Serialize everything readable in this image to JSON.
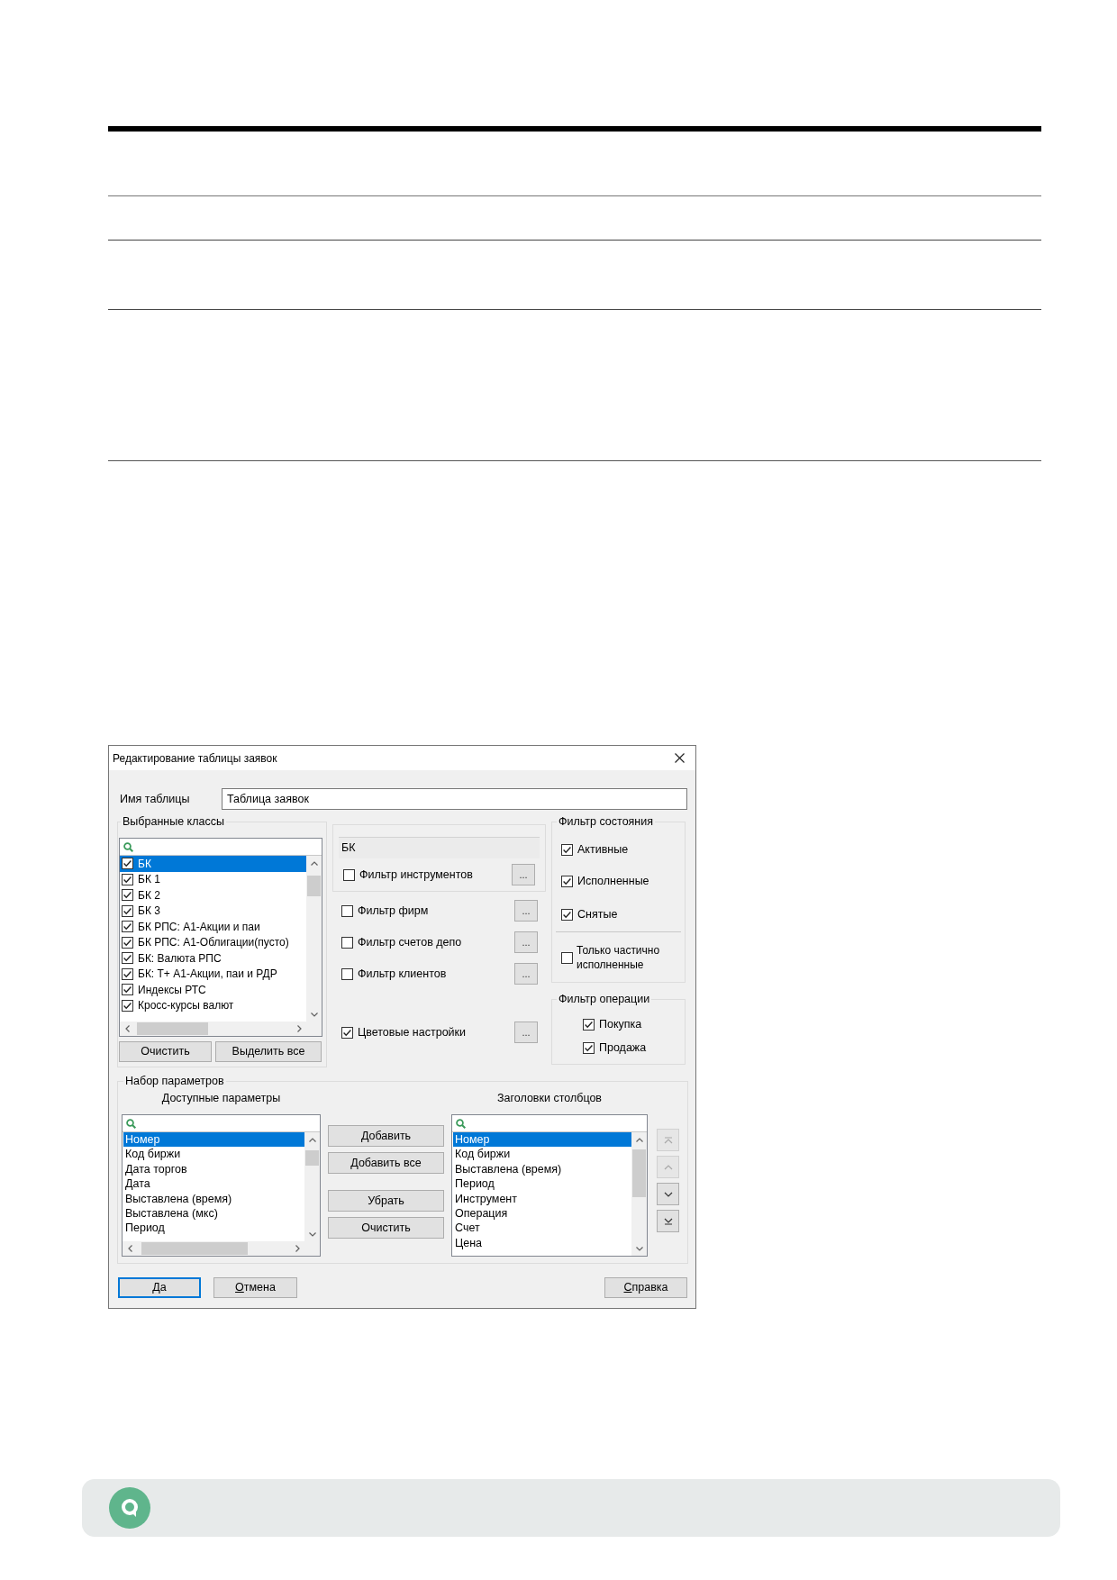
{
  "dialog": {
    "title": "Редактирование таблицы заявок",
    "table_name": {
      "label": "Имя таблицы",
      "value": "Таблица заявок"
    },
    "selected_classes": {
      "title": "Выбранные классы",
      "items": [
        {
          "label": "БК",
          "checked": true,
          "selected": true
        },
        {
          "label": "БК 1",
          "checked": true,
          "selected": false
        },
        {
          "label": "БК 2",
          "checked": true,
          "selected": false
        },
        {
          "label": "БК 3",
          "checked": true,
          "selected": false
        },
        {
          "label": "БК РПС: А1-Акции и паи",
          "checked": true,
          "selected": false
        },
        {
          "label": "БК РПС: А1-Облигации(пусто)",
          "checked": true,
          "selected": false
        },
        {
          "label": "БК: Валюта РПС",
          "checked": true,
          "selected": false
        },
        {
          "label": "БК: Т+ А1-Акции, паи и РДР",
          "checked": true,
          "selected": false
        },
        {
          "label": "Индексы РТС",
          "checked": true,
          "selected": false
        },
        {
          "label": "Кросс-курсы валют",
          "checked": true,
          "selected": false
        }
      ],
      "buttons": [
        "Очистить",
        "Выделить все"
      ]
    },
    "instrument_group": {
      "class_field": "БК",
      "filter": {
        "label": "Фильтр инструментов",
        "checked": false,
        "button": "..."
      }
    },
    "filters": [
      {
        "label": "Фильтр фирм",
        "checked": false,
        "button": "..."
      },
      {
        "label": "Фильтр счетов депо",
        "checked": false,
        "button": "..."
      },
      {
        "label": "Фильтр клиентов",
        "checked": false,
        "button": "..."
      }
    ],
    "color_settings": {
      "label": "Цветовые настройки",
      "checked": true,
      "button": "..."
    },
    "state_filter": {
      "title": "Фильтр состояния",
      "items": [
        {
          "label": "Активные",
          "checked": true
        },
        {
          "label": "Исполненные",
          "checked": true
        },
        {
          "label": "Снятые",
          "checked": true
        }
      ],
      "partial": {
        "label": "Только частично исполненные",
        "checked": false
      }
    },
    "operation_filter": {
      "title": "Фильтр операции",
      "items": [
        {
          "label": "Покупка",
          "checked": true
        },
        {
          "label": "Продажа",
          "checked": true
        }
      ]
    },
    "parameter_set": {
      "title": "Набор параметров",
      "available": {
        "title": "Доступные параметры",
        "items": [
          {
            "label": "Номер",
            "selected": true
          },
          {
            "label": "Код биржи",
            "selected": false
          },
          {
            "label": "Дата торгов",
            "selected": false
          },
          {
            "label": "Дата",
            "selected": false
          },
          {
            "label": "Выставлена (время)",
            "selected": false
          },
          {
            "label": "Выставлена (мкс)",
            "selected": false
          },
          {
            "label": "Период",
            "selected": false
          }
        ]
      },
      "buttons": [
        "Добавить",
        "Добавить все",
        "Убрать",
        "Очистить"
      ],
      "columns": {
        "title": "Заголовки столбцов",
        "items": [
          {
            "label": "Номер",
            "selected": true
          },
          {
            "label": "Код биржи",
            "selected": false
          },
          {
            "label": "Выставлена (время)",
            "selected": false
          },
          {
            "label": "Период",
            "selected": false
          },
          {
            "label": "Инструмент",
            "selected": false
          },
          {
            "label": "Операция",
            "selected": false
          },
          {
            "label": "Счет",
            "selected": false
          },
          {
            "label": "Цена",
            "selected": false
          }
        ]
      },
      "order_buttons": [
        {
          "kind": "top",
          "disabled": true
        },
        {
          "kind": "up",
          "disabled": true
        },
        {
          "kind": "down",
          "disabled": false
        },
        {
          "kind": "bottom",
          "disabled": false
        }
      ]
    },
    "footer_buttons": [
      {
        "label": "Да",
        "default": true
      },
      {
        "label": "Отмена",
        "default": false
      },
      {
        "label": "Справка",
        "default": false
      }
    ]
  }
}
